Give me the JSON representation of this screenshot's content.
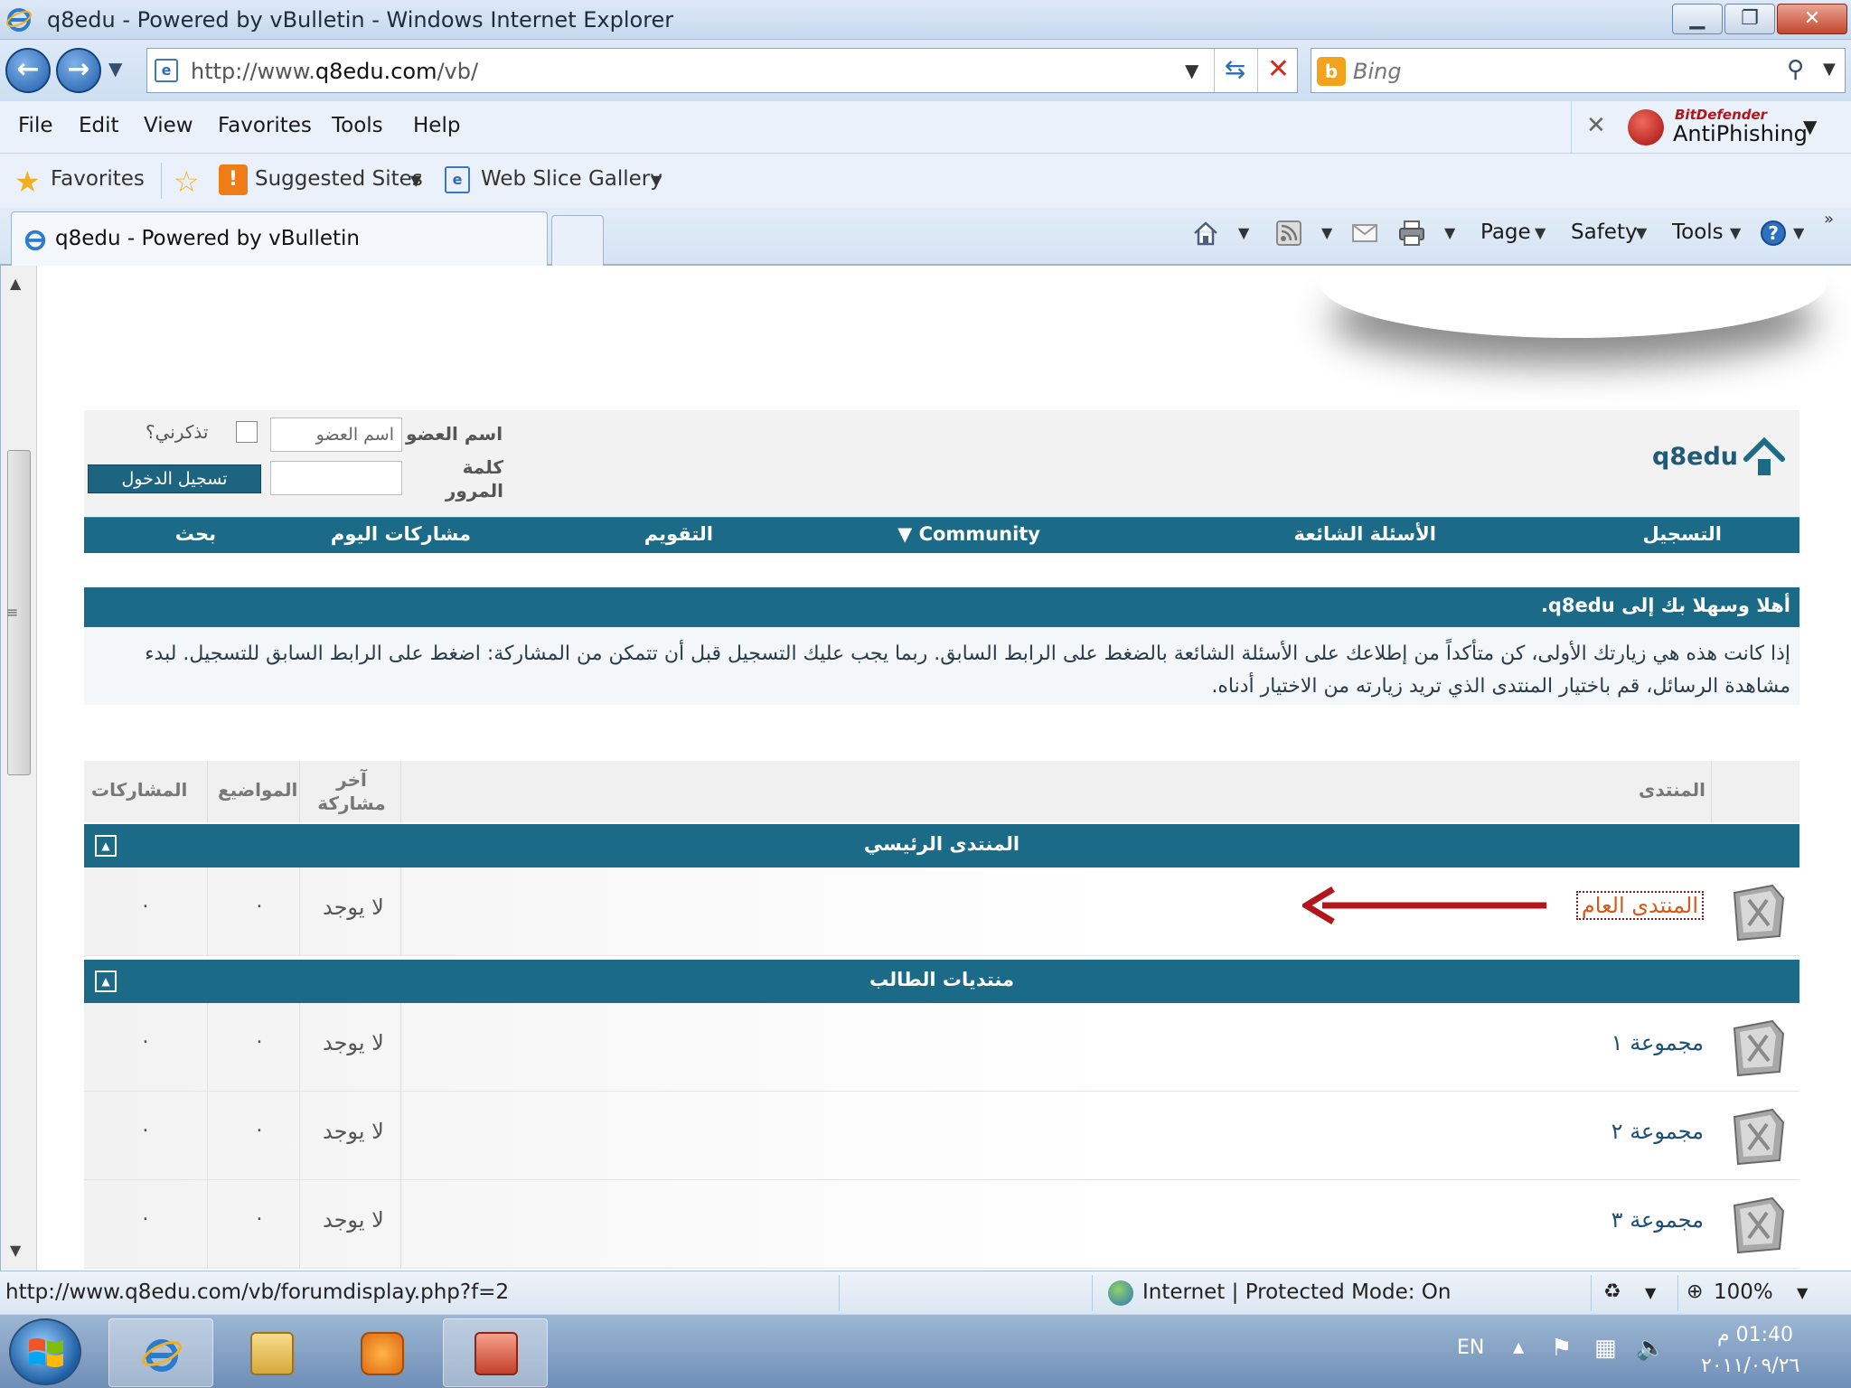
{
  "window": {
    "title": "q8edu - Powered by vBulletin - Windows Internet Explorer"
  },
  "address_bar": {
    "url_prefix": "http://www.",
    "url_host": "q8edu.com",
    "url_suffix": "/vb/",
    "search_placeholder": "Bing"
  },
  "menu": {
    "items": [
      "File",
      "Edit",
      "View",
      "Favorites",
      "Tools",
      "Help"
    ],
    "antiphishing_brand": "BitDefender",
    "antiphishing_label": "AntiPhishing"
  },
  "favorites_bar": {
    "favorites": "Favorites",
    "suggested_sites": "Suggested Sites",
    "web_slice_gallery": "Web Slice Gallery"
  },
  "tab": {
    "title": "q8edu - Powered by vBulletin"
  },
  "command_bar": {
    "page": "Page",
    "safety": "Safety",
    "tools": "Tools"
  },
  "forum": {
    "logo_text": "q8edu",
    "login": {
      "username_label": "اسم العضو",
      "username_value": "اسم العضو",
      "remember_label": "تذكرني؟",
      "password_label": "كلمة المرور",
      "login_button": "تسجيل الدخول"
    },
    "nav": {
      "register": "التسجيل",
      "faq": "الأسئلة الشائعة",
      "community": "Community",
      "calendar": "التقويم",
      "todays_posts": "مشاركات اليوم",
      "search": "بحث"
    },
    "welcome": {
      "title": "أهلا وسهلا بك إلى q8edu.",
      "body": "إذا كانت هذه هي زيارتك الأولى، كن متأكداً من إطلاعك على الأسئلة الشائعة بالضغط على الرابط السابق. ربما يجب عليك التسجيل قبل أن تتمكن من المشاركة: اضغط على الرابط السابق للتسجيل. لبدء مشاهدة الرسائل، قم باختيار المنتدى الذي تريد زيارته من الاختيار أدناه."
    },
    "columns": {
      "forum": "المنتدى",
      "last_post": "آخر مشاركة",
      "threads": "المواضيع",
      "posts": "المشاركات"
    },
    "categories": [
      {
        "title": "المنتدى الرئيسي",
        "forums": [
          {
            "name": "المنتدى العام",
            "last_post": "لا يوجد",
            "threads": "٠",
            "posts": "٠"
          }
        ]
      },
      {
        "title": "منتديات الطالب",
        "forums": [
          {
            "name": "مجموعة ١",
            "last_post": "لا يوجد",
            "threads": "٠",
            "posts": "٠"
          },
          {
            "name": "مجموعة ٢",
            "last_post": "لا يوجد",
            "threads": "٠",
            "posts": "٠"
          },
          {
            "name": "مجموعة ٣",
            "last_post": "لا يوجد",
            "threads": "٠",
            "posts": "٠"
          }
        ]
      }
    ]
  },
  "status_bar": {
    "url": "http://www.q8edu.com/vb/forumdisplay.php?f=2",
    "zone": "Internet | Protected Mode: On",
    "zoom": "100%"
  },
  "taskbar": {
    "language": "EN",
    "time": "01:40 م",
    "date": "٢٠١١/٠٩/٢٦"
  },
  "colors": {
    "forum_accent": "#1b6a87",
    "highlight_link": "#d75b17",
    "arrow": "#b3151b"
  }
}
